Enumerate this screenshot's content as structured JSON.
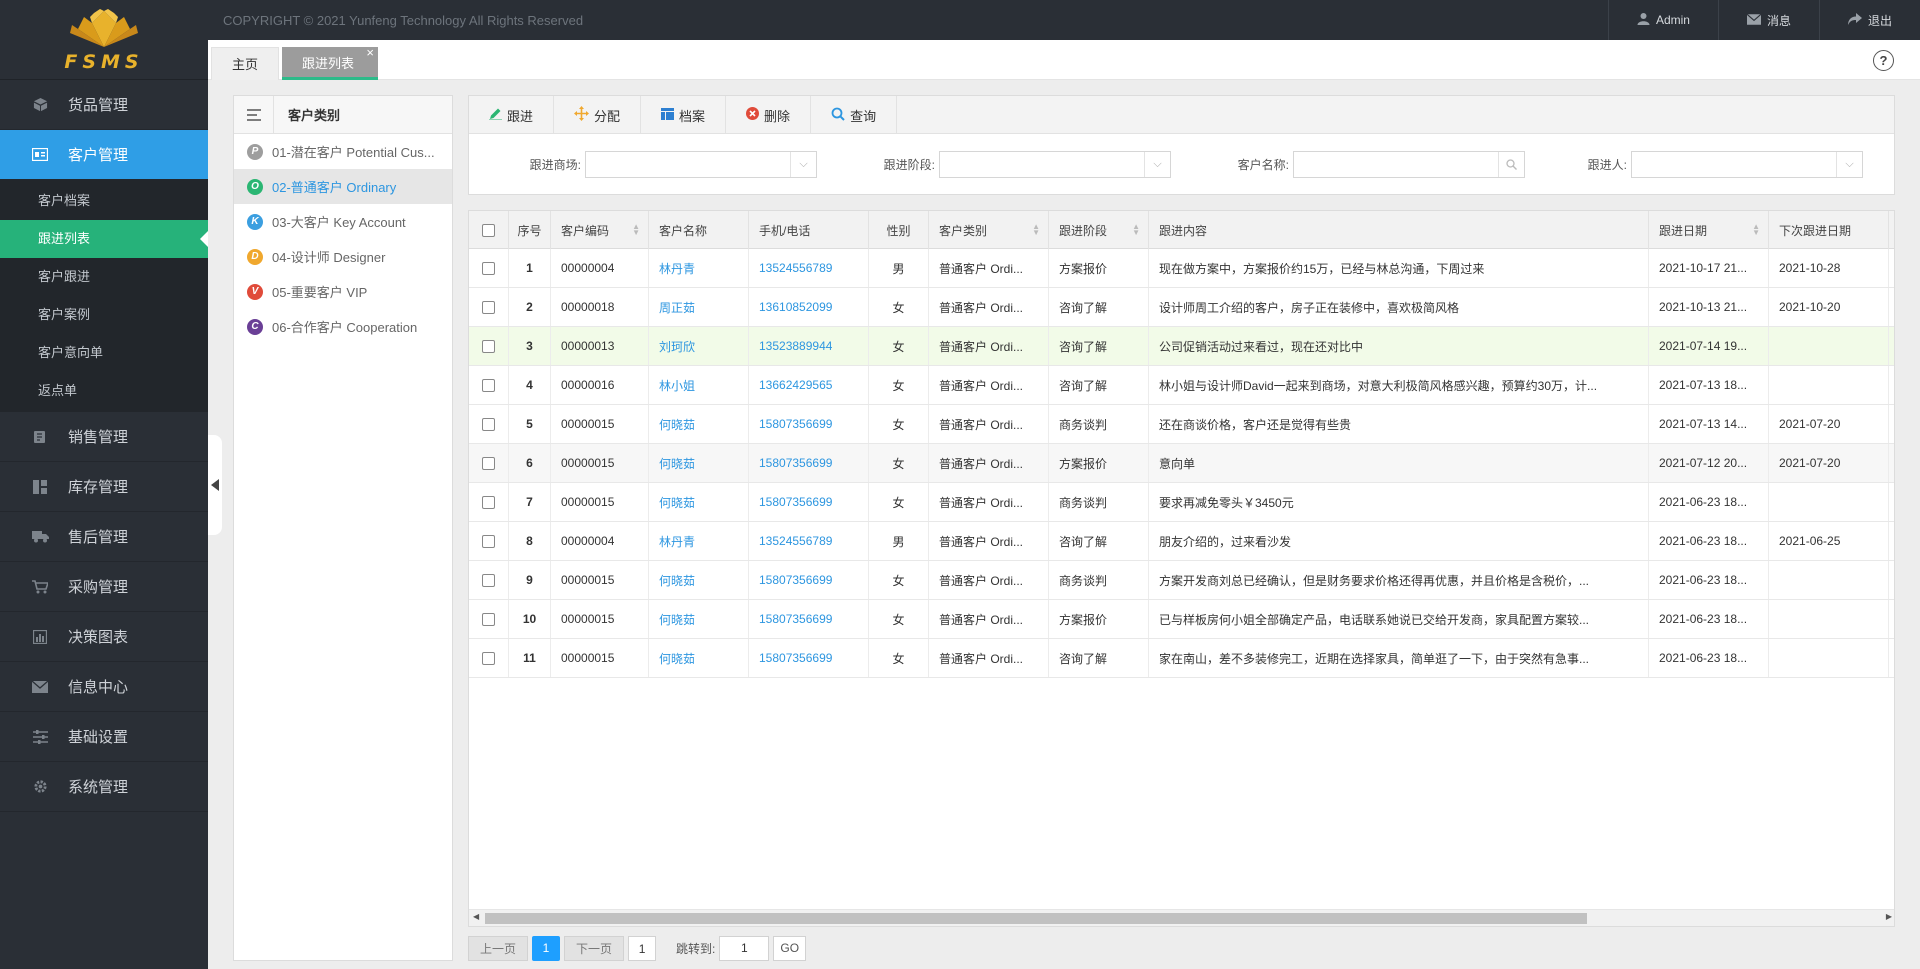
{
  "brand": {
    "logo_text": "FSMS"
  },
  "topbar": {
    "copyright": "COPYRIGHT © 2021 Yunfeng Technology All Rights Reserved",
    "user_label": "Admin",
    "message_label": "消息",
    "logout_label": "退出"
  },
  "sidebar": {
    "items": [
      {
        "label": "货品管理",
        "icon": "box-icon"
      },
      {
        "label": "客户管理",
        "icon": "customer-card-icon"
      },
      {
        "label": "销售管理",
        "icon": "sales-icon"
      },
      {
        "label": "库存管理",
        "icon": "inventory-icon"
      },
      {
        "label": "售后管理",
        "icon": "truck-icon"
      },
      {
        "label": "采购管理",
        "icon": "cart-icon"
      },
      {
        "label": "决策图表",
        "icon": "chart-icon"
      },
      {
        "label": "信息中心",
        "icon": "envelope-icon"
      },
      {
        "label": "基础设置",
        "icon": "sliders-icon"
      },
      {
        "label": "系统管理",
        "icon": "gear-icon"
      }
    ],
    "sub_items": [
      "客户档案",
      "跟进列表",
      "客户跟进",
      "客户案例",
      "客户意向单",
      "返点单"
    ]
  },
  "tabs": {
    "home": "主页",
    "current": "跟进列表",
    "close": "×"
  },
  "category_panel": {
    "title": "客户类别",
    "items": [
      {
        "badge": "P",
        "label": "01-潜在客户 Potential Cus...",
        "color": "#9e9e9e"
      },
      {
        "badge": "O",
        "label": "02-普通客户 Ordinary",
        "color": "#2bb673"
      },
      {
        "badge": "K",
        "label": "03-大客户 Key Account",
        "color": "#3b9fe0"
      },
      {
        "badge": "D",
        "label": "04-设计师 Designer",
        "color": "#f0a82e"
      },
      {
        "badge": "V",
        "label": "05-重要客户 VIP",
        "color": "#e04b3a"
      },
      {
        "badge": "C",
        "label": "06-合作客户 Cooperation",
        "color": "#6a3f96"
      }
    ]
  },
  "toolbar": {
    "followup": "跟进",
    "assign": "分配",
    "archive": "档案",
    "delete": "删除",
    "query": "查询"
  },
  "filters": {
    "mall_label": "跟进商场:",
    "stage_label": "跟进阶段:",
    "customer_name_label": "客户名称:",
    "follower_label": "跟进人:"
  },
  "table": {
    "columns": [
      "序号",
      "客户编码",
      "客户名称",
      "手机/电话",
      "性别",
      "客户类别",
      "跟进阶段",
      "跟进内容",
      "跟进日期",
      "下次跟进日期"
    ],
    "rows": [
      {
        "no": "1",
        "code": "00000004",
        "name": "林丹青",
        "phone": "13524556789",
        "gender": "男",
        "type": "普通客户 Ordi...",
        "stage": "方案报价",
        "content": "现在做方案中，方案报价约15万，已经与林总沟通，下周过来",
        "date": "2021-10-17 21...",
        "next": "2021-10-28"
      },
      {
        "no": "2",
        "code": "00000018",
        "name": "周正茹",
        "phone": "13610852099",
        "gender": "女",
        "type": "普通客户 Ordi...",
        "stage": "咨询了解",
        "content": "设计师周工介绍的客户，房子正在装修中，喜欢极简风格",
        "date": "2021-10-13 21...",
        "next": "2021-10-20"
      },
      {
        "no": "3",
        "code": "00000013",
        "name": "刘珂欣",
        "phone": "13523889944",
        "gender": "女",
        "type": "普通客户 Ordi...",
        "stage": "咨询了解",
        "content": "公司促销活动过来看过，现在还对比中",
        "date": "2021-07-14 19...",
        "next": ""
      },
      {
        "no": "4",
        "code": "00000016",
        "name": "林小姐",
        "phone": "13662429565",
        "gender": "女",
        "type": "普通客户 Ordi...",
        "stage": "咨询了解",
        "content": "林小姐与设计师David一起来到商场，对意大利极简风格感兴趣，预算约30万，计...",
        "date": "2021-07-13 18...",
        "next": ""
      },
      {
        "no": "5",
        "code": "00000015",
        "name": "何晓茹",
        "phone": "15807356699",
        "gender": "女",
        "type": "普通客户 Ordi...",
        "stage": "商务谈判",
        "content": "还在商谈价格，客户还是觉得有些贵",
        "date": "2021-07-13 14...",
        "next": "2021-07-20"
      },
      {
        "no": "6",
        "code": "00000015",
        "name": "何晓茹",
        "phone": "15807356699",
        "gender": "女",
        "type": "普通客户 Ordi...",
        "stage": "方案报价",
        "content": "意向单",
        "date": "2021-07-12 20...",
        "next": "2021-07-20"
      },
      {
        "no": "7",
        "code": "00000015",
        "name": "何晓茹",
        "phone": "15807356699",
        "gender": "女",
        "type": "普通客户 Ordi...",
        "stage": "商务谈判",
        "content": "要求再减免零头￥3450元",
        "date": "2021-06-23 18...",
        "next": ""
      },
      {
        "no": "8",
        "code": "00000004",
        "name": "林丹青",
        "phone": "13524556789",
        "gender": "男",
        "type": "普通客户 Ordi...",
        "stage": "咨询了解",
        "content": "朋友介绍的，过来看沙发",
        "date": "2021-06-23 18...",
        "next": "2021-06-25"
      },
      {
        "no": "9",
        "code": "00000015",
        "name": "何晓茹",
        "phone": "15807356699",
        "gender": "女",
        "type": "普通客户 Ordi...",
        "stage": "商务谈判",
        "content": "方案开发商刘总已经确认，但是财务要求价格还得再优惠，并且价格是含税价，...",
        "date": "2021-06-23 18...",
        "next": ""
      },
      {
        "no": "10",
        "code": "00000015",
        "name": "何晓茹",
        "phone": "15807356699",
        "gender": "女",
        "type": "普通客户 Ordi...",
        "stage": "方案报价",
        "content": "已与样板房何小姐全部确定产品，电话联系她说已交给开发商，家具配置方案较...",
        "date": "2021-06-23 18...",
        "next": ""
      },
      {
        "no": "11",
        "code": "00000015",
        "name": "何晓茹",
        "phone": "15807356699",
        "gender": "女",
        "type": "普通客户 Ordi...",
        "stage": "咨询了解",
        "content": "家在南山，差不多装修完工，近期在选择家具，简单逛了一下，由于突然有急事...",
        "date": "2021-06-23 18...",
        "next": ""
      }
    ]
  },
  "pager": {
    "prev": "上一页",
    "current": "1",
    "next": "下一页",
    "total": "1",
    "jump_label": "跳转到:",
    "jump_value": "1",
    "go": "GO"
  },
  "colors": {
    "accent": "#2f9ee6",
    "active_sub": "#26b27a",
    "sidebar_bg": "#2a2f36",
    "link": "#2d96e0"
  }
}
